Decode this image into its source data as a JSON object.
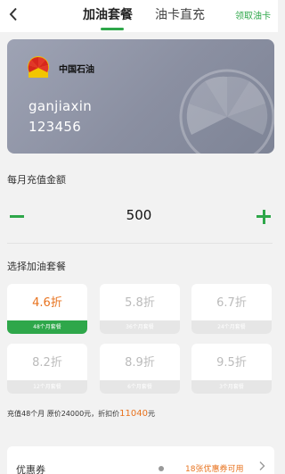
{
  "header": {
    "tabs": [
      {
        "label": "加油套餐",
        "active": true
      },
      {
        "label": "油卡直充",
        "active": false
      }
    ],
    "claim_label": "领取油卡",
    "accent": "#2ea74a"
  },
  "card": {
    "brand": "中国石油",
    "username": "ganjiaxin",
    "number": "123456"
  },
  "recharge": {
    "label": "每月充值金额",
    "amount": "500"
  },
  "packages": {
    "label": "选择加油套餐",
    "items": [
      {
        "discount": "4.6折",
        "term": "48个月套餐",
        "selected": true
      },
      {
        "discount": "5.8折",
        "term": "36个月套餐",
        "selected": false
      },
      {
        "discount": "6.7折",
        "term": "24个月套餐",
        "selected": false
      },
      {
        "discount": "8.2折",
        "term": "12个月套餐",
        "selected": false
      },
      {
        "discount": "8.9折",
        "term": "6个月套餐",
        "selected": false
      },
      {
        "discount": "9.5折",
        "term": "3个月套餐",
        "selected": false
      }
    ]
  },
  "summary": {
    "prefix": "充值48个月 原价24000元，折扣价",
    "price": "11040",
    "suffix": "元"
  },
  "coupon": {
    "label": "优惠券",
    "available": "18张优惠券可用"
  }
}
